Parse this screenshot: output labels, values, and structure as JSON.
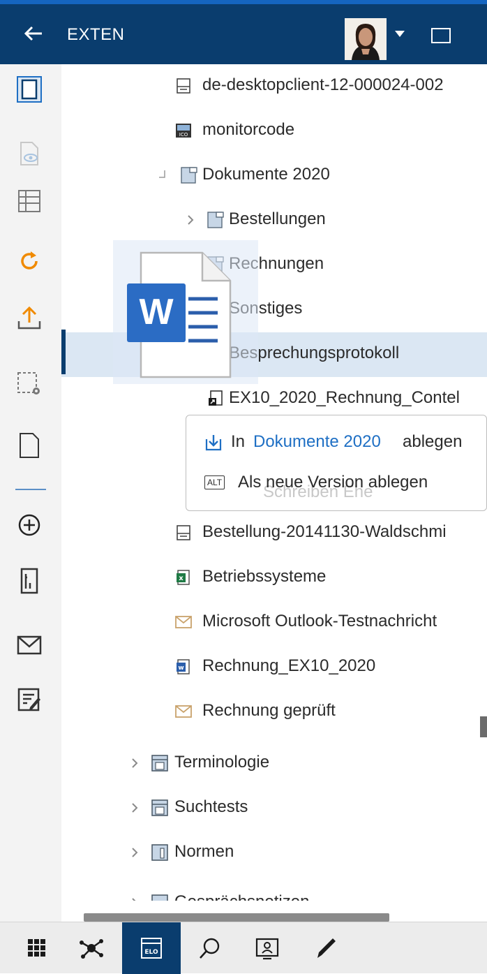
{
  "header": {
    "title": "EXTEN",
    "back_icon": "arrow-left-icon",
    "avatar_icon": "user-avatar",
    "panel_icon": "panel-toggle-icon"
  },
  "rail": {
    "items": [
      {
        "name": "document-view-icon",
        "active": true
      },
      {
        "name": "preview-icon",
        "disabled": true
      },
      {
        "name": "list-view-icon"
      },
      {
        "name": "refresh-icon"
      },
      {
        "name": "upload-icon"
      },
      {
        "name": "selection-settings-icon"
      },
      {
        "name": "new-document-icon"
      },
      {
        "name": "add-circle-icon"
      },
      {
        "name": "form-icon"
      },
      {
        "name": "mail-icon"
      },
      {
        "name": "edit-list-icon"
      }
    ]
  },
  "tree": {
    "items": [
      {
        "label": "de-desktopclient-12-000024-002",
        "icon": "document-icon"
      },
      {
        "label": "monitorcode",
        "icon": "ico-file-icon"
      },
      {
        "label": "Dokumente 2020",
        "icon": "folder-icon"
      },
      {
        "label": "Bestellungen",
        "icon": "folder-icon"
      },
      {
        "label": "Rechnungen",
        "icon": "folder-icon"
      },
      {
        "label": "Sonstiges",
        "icon": "folder-icon"
      },
      {
        "label": "Besprechungsprotokoll",
        "icon": "word-file-icon"
      },
      {
        "label": "EX10_2020_Rechnung_Contel",
        "icon": "reference-icon"
      },
      {
        "label": "Bestellung-20141130-Waldschmi",
        "icon": "document-icon"
      },
      {
        "label": "Betriebssysteme",
        "icon": "excel-file-icon"
      },
      {
        "label": "Microsoft Outlook-Testnachricht",
        "icon": "mail-icon"
      },
      {
        "label": "Rechnung_EX10_2020",
        "icon": "word-file-icon"
      },
      {
        "label": "Rechnung geprüft",
        "icon": "mail-icon"
      },
      {
        "label": "Terminologie",
        "icon": "cabinet-icon"
      },
      {
        "label": "Suchtests",
        "icon": "cabinet-icon"
      },
      {
        "label": "Normen",
        "icon": "register-icon"
      },
      {
        "label": "Gesprächsnotizen",
        "icon": "register-icon"
      }
    ]
  },
  "drop_popup": {
    "line1_prefix": "In",
    "line1_link": "Dokumente 2020",
    "line1_suffix": "ablegen",
    "line2_key": "ALT",
    "line2_text": "Als neue Version ablegen",
    "underlying_text": "Schreiben Ehe"
  },
  "drag_ghost": {
    "icon": "word-document-icon",
    "letter": "W"
  },
  "bottom_nav": {
    "items": [
      {
        "name": "apps-grid-icon"
      },
      {
        "name": "network-icon"
      },
      {
        "name": "elo-repository-icon",
        "active": true,
        "label": "ELO"
      },
      {
        "name": "search-icon"
      },
      {
        "name": "contacts-icon"
      },
      {
        "name": "pen-icon"
      }
    ]
  }
}
